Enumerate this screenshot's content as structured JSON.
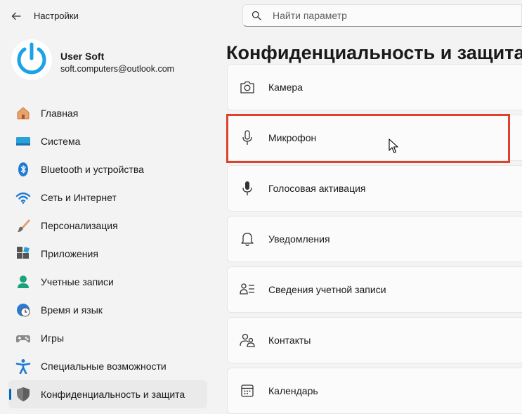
{
  "titlebar": {
    "app_title": "Настройки",
    "back_icon": "back-arrow-icon"
  },
  "search": {
    "placeholder": "Найти параметр",
    "icon": "search-icon"
  },
  "user": {
    "name": "User Soft",
    "email": "soft.computers@outlook.com"
  },
  "nav": {
    "items": [
      {
        "label": "Главная",
        "icon": "home-icon"
      },
      {
        "label": "Система",
        "icon": "system-icon"
      },
      {
        "label": "Bluetooth и устройства",
        "icon": "bluetooth-icon"
      },
      {
        "label": "Сеть и Интернет",
        "icon": "wifi-icon"
      },
      {
        "label": "Персонализация",
        "icon": "brush-icon"
      },
      {
        "label": "Приложения",
        "icon": "apps-icon"
      },
      {
        "label": "Учетные записи",
        "icon": "accounts-icon"
      },
      {
        "label": "Время и язык",
        "icon": "time-language-icon"
      },
      {
        "label": "Игры",
        "icon": "gamepad-icon"
      },
      {
        "label": "Специальные возможности",
        "icon": "accessibility-icon"
      },
      {
        "label": "Конфиденциальность и защита",
        "icon": "shield-icon",
        "active": true
      }
    ]
  },
  "main": {
    "title": "Конфиденциальность и защита",
    "items": [
      {
        "label": "Камера",
        "icon": "camera-icon"
      },
      {
        "label": "Микрофон",
        "icon": "microphone-icon",
        "highlighted": true
      },
      {
        "label": "Голосовая активация",
        "icon": "voice-activation-icon"
      },
      {
        "label": "Уведомления",
        "icon": "bell-icon"
      },
      {
        "label": "Сведения учетной записи",
        "icon": "account-info-icon"
      },
      {
        "label": "Контакты",
        "icon": "contacts-icon"
      },
      {
        "label": "Календарь",
        "icon": "calendar-icon"
      }
    ]
  },
  "colors": {
    "accent": "#0067c0",
    "highlight": "#e0412d",
    "background": "#f3f3f3",
    "card": "#fbfbfb"
  }
}
